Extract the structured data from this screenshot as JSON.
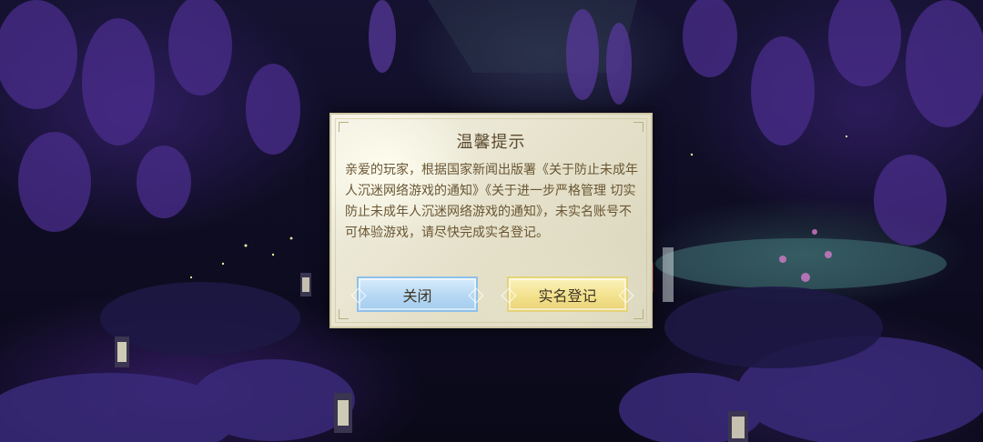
{
  "dialog": {
    "title": "温馨提示",
    "body": "亲爱的玩家，根据国家新闻出版署《关于防止未成年人沉迷网络游戏的通知》《关于进一步严格管理 切实防止未成年人沉迷网络游戏的通知》，未实名账号不可体验游戏，请尽快完成实名登记。",
    "close_label": "关闭",
    "realname_label": "实名登记"
  },
  "colors": {
    "close_button": "#b3d6f3",
    "realname_button": "#f2e08a",
    "dialog_background": "#e9e6d2",
    "text": "#6a5634"
  }
}
